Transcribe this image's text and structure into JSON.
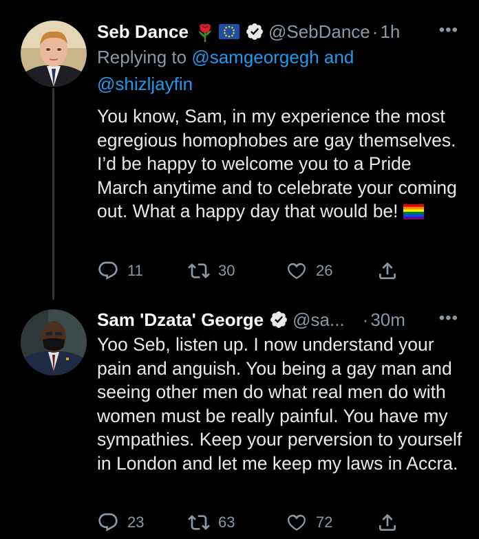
{
  "tweet1": {
    "name": "Seb Dance",
    "handle": "@SebDance",
    "dot": "·",
    "time": "1h",
    "replying_prefix": "Replying to ",
    "reply_user1": "@samgeorgegh",
    "reply_and": " and",
    "reply_user2": "@shizljayfin",
    "text": "You know, Sam, in my experience the most egregious homophobes are gay themselves. I’d be happy to welcome you to a Pride March anytime and to celebrate your coming out. What a happy day that would be!",
    "reply_count": "11",
    "retweet_count": "30",
    "like_count": "26"
  },
  "tweet2": {
    "name": "Sam 'Dzata' George",
    "handle": "@sa...",
    "dot": "·",
    "time": "30m",
    "text": "Yoo Seb, listen up. I now understand your pain and anguish. You being a gay man and seeing other men do what real men do with women must be really painful. You have my sympathies. Keep your perversion to yourself in London and let me keep my laws in Accra.",
    "reply_count": "23",
    "retweet_count": "63",
    "like_count": "72"
  },
  "more_label": "•••",
  "colors": {
    "background": "#000000",
    "link": "#1d9bf0",
    "muted": "#8b98a5",
    "text": "#e7e9ea"
  }
}
